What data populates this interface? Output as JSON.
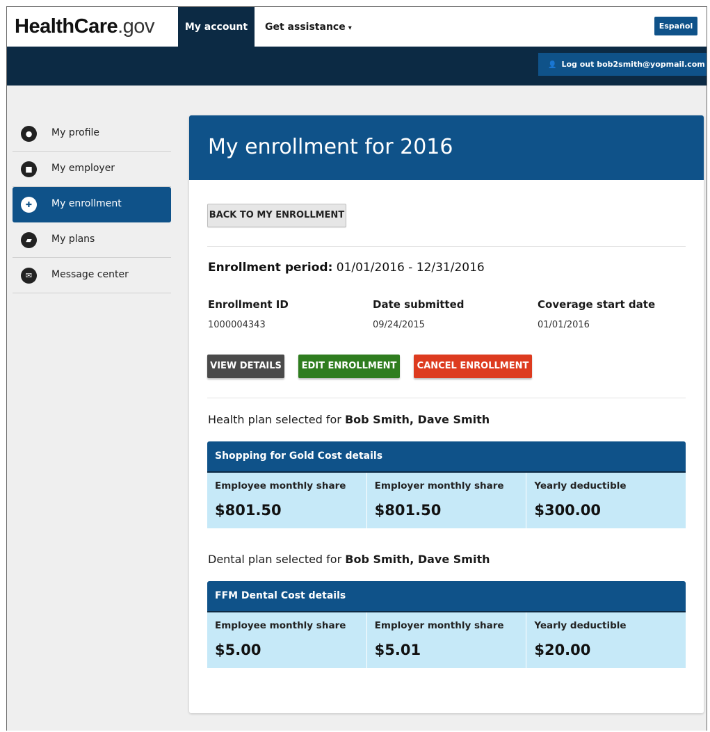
{
  "header": {
    "logo_health_care": "HealthCare",
    "logo_gov": ".gov",
    "nav_my_account": "My account",
    "nav_get_assistance": "Get assistance",
    "nav_caret": "▾",
    "espanol": "Español",
    "logout_icon": "👤",
    "logout": "Log out bob2smith@yopmail.com"
  },
  "sidebar": {
    "items": [
      {
        "label": "My profile",
        "icon": "person-icon",
        "glyph": "●"
      },
      {
        "label": "My employer",
        "icon": "briefcase-icon",
        "glyph": "■"
      },
      {
        "label": "My enrollment",
        "icon": "medical-kit-icon",
        "glyph": "✚",
        "active": true
      },
      {
        "label": "My plans",
        "icon": "document-icon",
        "glyph": "▰"
      },
      {
        "label": "Message center",
        "icon": "envelope-icon",
        "glyph": "✉"
      }
    ]
  },
  "main": {
    "title": "My enrollment for 2016",
    "back_button": "BACK TO MY ENROLLMENT",
    "period_label": "Enrollment period:",
    "period_value": " 01/01/2016 - 12/31/2016",
    "columns": [
      {
        "label": "Enrollment ID",
        "value": "1000004343"
      },
      {
        "label": "Date submitted",
        "value": "09/24/2015"
      },
      {
        "label": "Coverage start date",
        "value": "01/01/2016"
      }
    ],
    "view_details": "VIEW DETAILS",
    "edit_enrollment": "EDIT ENROLLMENT",
    "cancel_enrollment": "CANCEL ENROLLMENT",
    "health": {
      "selected_prefix": "Health plan selected for ",
      "selected_names": "Bob Smith, Dave Smith",
      "table_title": "Shopping for Gold Cost details",
      "cells": [
        {
          "label": "Employee monthly share",
          "value": "$801.50"
        },
        {
          "label": "Employer monthly share",
          "value": "$801.50"
        },
        {
          "label": "Yearly deductible",
          "value": "$300.00"
        }
      ]
    },
    "dental": {
      "selected_prefix": "Dental plan selected for ",
      "selected_names": "Bob Smith, Dave Smith",
      "table_title": "FFM Dental Cost details",
      "cells": [
        {
          "label": "Employee monthly share",
          "value": "$5.00"
        },
        {
          "label": "Employer monthly share",
          "value": "$5.01"
        },
        {
          "label": "Yearly deductible",
          "value": "$20.00"
        }
      ]
    }
  },
  "colors": {
    "primary_blue": "#0f5289",
    "dark_navy": "#0c2a44",
    "success_green": "#2f7d1f",
    "danger_red": "#dd3b1f",
    "light_blue": "#c6e9f8"
  }
}
